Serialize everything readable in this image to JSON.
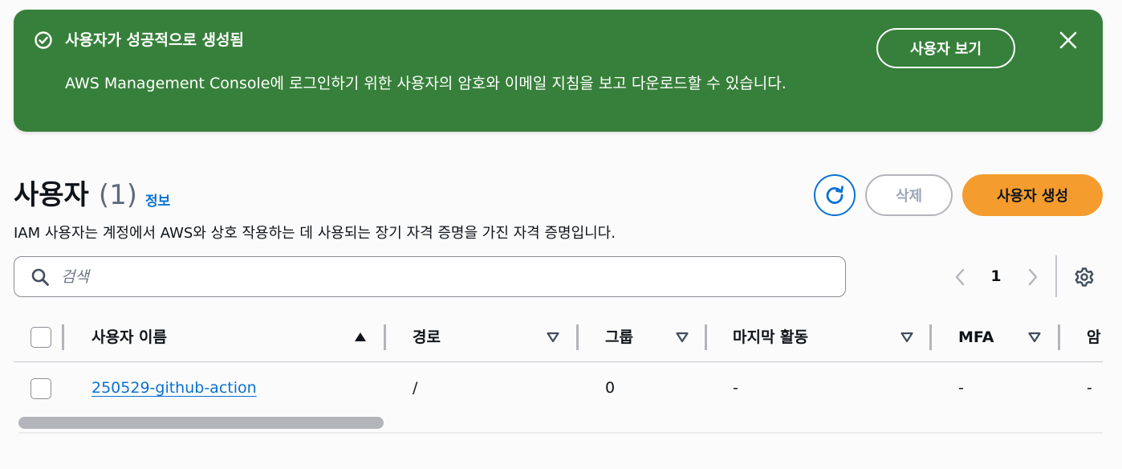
{
  "flash": {
    "title": "사용자가 성공적으로 생성됨",
    "message": "AWS Management Console에 로그인하기 위한 사용자의 암호와 이메일 지침을 보고 다운로드할 수 있습니다.",
    "view_button": "사용자 보기",
    "status_icon": "success-check-icon",
    "close_icon": "close-icon",
    "color": "#37803b"
  },
  "header": {
    "title": "사용자",
    "count": "(1)",
    "info_link": "정보",
    "description": "IAM 사용자는 계정에서 AWS와 상호 작용하는 데 사용되는 장기 자격 증명을 가진 자격 증명입니다."
  },
  "actions": {
    "refresh_icon": "refresh-icon",
    "delete_label": "삭제",
    "create_label": "사용자 생성",
    "create_color": "#f49c2d"
  },
  "search": {
    "placeholder": "검색",
    "value": ""
  },
  "pagination": {
    "current_page": "1"
  },
  "table": {
    "columns": [
      {
        "label": "사용자 이름",
        "sort": "ascending"
      },
      {
        "label": "경로",
        "sort": "none"
      },
      {
        "label": "그룹",
        "sort": "none"
      },
      {
        "label": "마지막 활동",
        "sort": "none"
      },
      {
        "label": "MFA",
        "sort": "none"
      },
      {
        "label": "암"
      }
    ],
    "rows": [
      {
        "user_name": "250529-github-action",
        "path": "/",
        "groups": "0",
        "last_activity": "-",
        "mfa": "-",
        "next": "-"
      }
    ]
  },
  "colors": {
    "link": "#0972d3",
    "success": "#37803b",
    "primary_button": "#f49c2d"
  }
}
